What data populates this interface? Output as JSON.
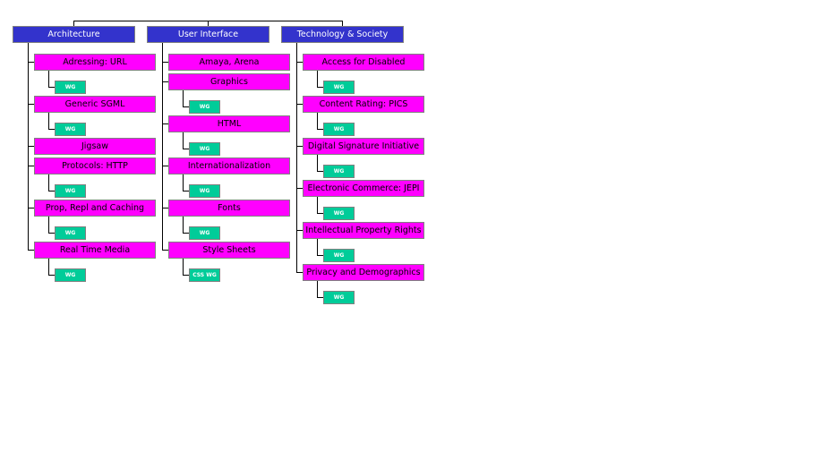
{
  "colors": {
    "category_fill": "#3333cc",
    "category_text": "#ffffff",
    "topic_fill": "#ff00ff",
    "topic_text": "#000000",
    "group_fill": "#00cc99",
    "group_text": "#ffffff",
    "border": "#808080",
    "connector": "#000000"
  },
  "columns": [
    {
      "label": "Architecture",
      "items": [
        {
          "label": "Adressing: URL",
          "group": "WG"
        },
        {
          "label": "Generic SGML",
          "group": "WG"
        },
        {
          "label": "Jigsaw",
          "group": null
        },
        {
          "label": "Protocols: HTTP",
          "group": "WG"
        },
        {
          "label": "Prop, Repl and Caching",
          "group": "WG"
        },
        {
          "label": "Real Time Media",
          "group": "WG"
        }
      ]
    },
    {
      "label": "User Interface",
      "items": [
        {
          "label": "Amaya, Arena",
          "group": null
        },
        {
          "label": "Graphics",
          "group": "WG"
        },
        {
          "label": "HTML",
          "group": "WG"
        },
        {
          "label": "Internationalization",
          "group": "WG"
        },
        {
          "label": "Fonts",
          "group": "WG"
        },
        {
          "label": "Style Sheets",
          "group": "CSS WG"
        }
      ]
    },
    {
      "label": "Technology & Society",
      "items": [
        {
          "label": "Access for Disabled",
          "group": "WG"
        },
        {
          "label": "Content Rating: PICS",
          "group": "WG"
        },
        {
          "label": "Digital Signature Initiative",
          "group": "WG"
        },
        {
          "label": "Electronic Commerce: JEPI",
          "group": "WG"
        },
        {
          "label": "Intellectual Property Rights",
          "group": "WG"
        },
        {
          "label": "Privacy and Demographics",
          "group": "WG"
        }
      ]
    }
  ]
}
